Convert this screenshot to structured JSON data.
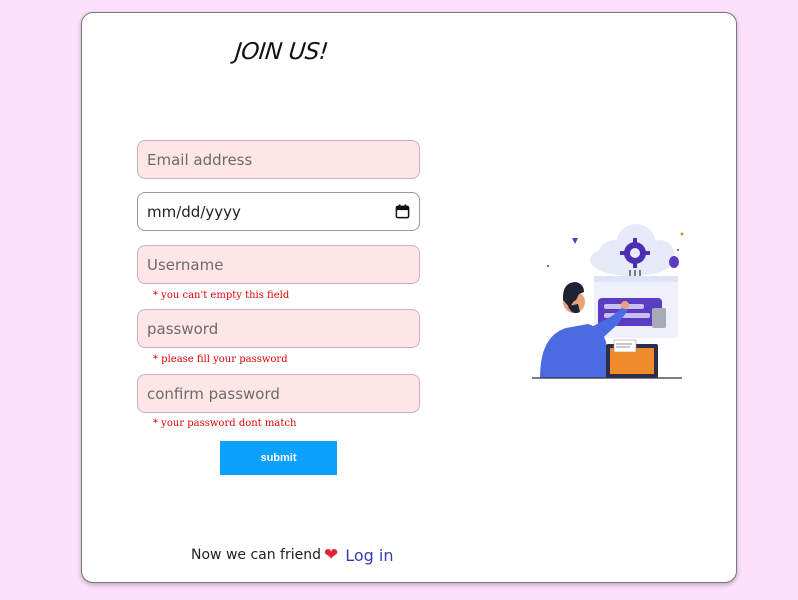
{
  "form": {
    "title": "JOIN US!",
    "email_placeholder": "Email address",
    "date_value": "mm/dd/yyyy",
    "username_placeholder": "Username",
    "username_error": "* you can't empty this field",
    "password_placeholder": "password",
    "password_error": "* please fill your password",
    "confirm_placeholder": "confirm password",
    "confirm_error": "* your password dont match",
    "submit_label": "submit"
  },
  "footer": {
    "text": "Now we can friend",
    "heart": "❤",
    "login_label": "Log in"
  },
  "colors": {
    "page_bg": "#fde0fb",
    "input_bg": "#ffe6e6",
    "submit_bg": "#0aa1ff",
    "error": "#e00000",
    "link": "#3a3ab0"
  },
  "icons": [
    "calendar-icon",
    "heart-icon",
    "cloud-settings-illustration"
  ]
}
